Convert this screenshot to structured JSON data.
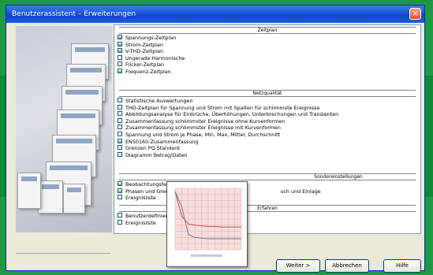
{
  "window": {
    "title": "Benutzerassistent – Erweiterungen",
    "close_label": "×"
  },
  "groups": [
    {
      "label": "Zeitplan"
    },
    {
      "label": "Netzqualität"
    },
    {
      "label": "Sondereinstellungen"
    },
    {
      "label": "Erfahren"
    }
  ],
  "items_group1": [
    {
      "label": "Spannungs-Zeitplan",
      "checked": true
    },
    {
      "label": "Strom-Zeitplan",
      "checked": true
    },
    {
      "label": "V-THD-Zeitplan",
      "checked": true
    },
    {
      "label": "Ungerade Harmonische",
      "checked": false
    },
    {
      "label": "Flicker-Zeitplan",
      "checked": false
    },
    {
      "label": "Frequenz-Zeitplan",
      "checked": true
    }
  ],
  "items_group2": [
    {
      "label": "Statistische Auswertungen",
      "checked": false
    },
    {
      "label": "THD-Zeitplan für Spannung und Strom mit Spalten für schlimmste Ereignisse",
      "checked": false
    },
    {
      "label": "Abbildungsanalyse für Einbrüche, Überhöhungen, Unterbrechungen und Transienten",
      "checked": false
    },
    {
      "label": "Zusammenfassung schlimmster Ereignisse ohne Kurvenformen",
      "checked": false
    },
    {
      "label": "Zusammenfassung schlimmster Ereignisse mit Kurvenformen",
      "checked": false
    },
    {
      "label": "Spannung und Strom je Phase, Min, Max, Mittel, Durchschnitt",
      "checked": false
    },
    {
      "label": "EN50160-Zusammenfassung",
      "checked": true
    },
    {
      "label": "Grenzen PQ Standard",
      "checked": false
    },
    {
      "label": "Diagramm Betrag/Daten",
      "checked": false
    }
  ],
  "items_group3": [
    {
      "label": "Beobachtungsfenster",
      "checked": true
    },
    {
      "label": "Phasen und Grenzwerte",
      "checked": true,
      "suffix": "uch und Einlage"
    },
    {
      "label": "Ereignisliste",
      "checked": false
    }
  ],
  "items_group4": [
    {
      "label": "Benutzerdefiniert",
      "checked": false
    },
    {
      "label": "Ereignisliste",
      "checked": false
    }
  ],
  "buttons": {
    "next": "Weiter >",
    "cancel": "Abbrechen",
    "help": "Hilfe"
  },
  "chart_data": {
    "type": "line",
    "x": [
      0,
      1,
      2,
      3,
      4,
      5,
      6,
      7,
      8,
      9,
      10
    ],
    "series": [
      {
        "values": [
          95,
          55,
          42,
          40,
          39,
          38,
          38,
          37,
          37,
          37,
          37
        ]
      },
      {
        "values": [
          95,
          70,
          25,
          20,
          19,
          18,
          18,
          18,
          18,
          18,
          18
        ]
      }
    ],
    "ylim": [
      0,
      100
    ],
    "grid": true,
    "colors": [
      "#c0504d",
      "#6c7b9a"
    ]
  }
}
